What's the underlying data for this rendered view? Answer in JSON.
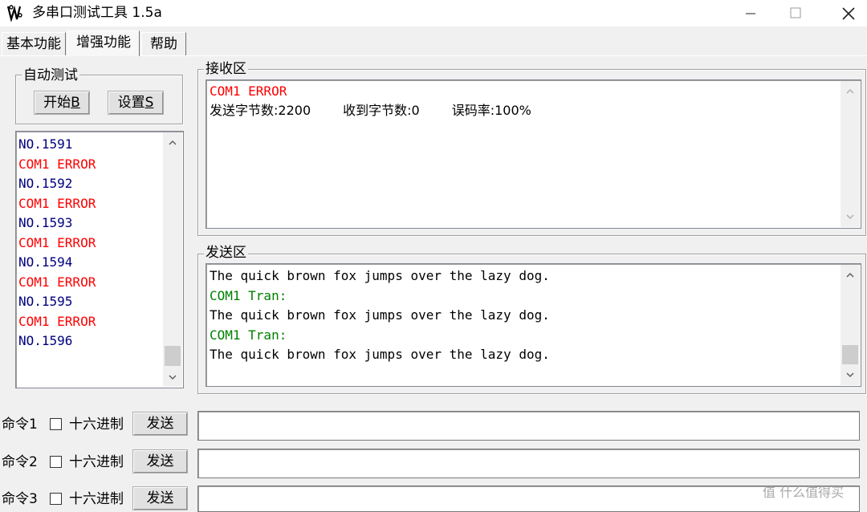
{
  "window": {
    "title": "多串口测试工具 1.5a",
    "minimize_glyph": "—",
    "maximize_glyph": "☐",
    "close_glyph": "✕"
  },
  "tabs": [
    {
      "label": "基本功能",
      "active": false
    },
    {
      "label": "增强功能",
      "active": true
    },
    {
      "label": "帮助",
      "active": false
    }
  ],
  "auto_test": {
    "group_label": "自动测试",
    "start_label": "开始",
    "start_hotkey": "B",
    "settings_label": "设置",
    "settings_hotkey": "S"
  },
  "log_list": {
    "lines": [
      {
        "text": "NO.1591",
        "color": "#00007f"
      },
      {
        "text": "COM1 ERROR",
        "color": "#ff0000"
      },
      {
        "text": "NO.1592",
        "color": "#00007f"
      },
      {
        "text": "COM1 ERROR",
        "color": "#ff0000"
      },
      {
        "text": "NO.1593",
        "color": "#00007f"
      },
      {
        "text": "COM1 ERROR",
        "color": "#ff0000"
      },
      {
        "text": "NO.1594",
        "color": "#00007f"
      },
      {
        "text": "COM1 ERROR",
        "color": "#ff0000"
      },
      {
        "text": "NO.1595",
        "color": "#00007f"
      },
      {
        "text": "COM1 ERROR",
        "color": "#ff0000"
      },
      {
        "text": "NO.1596",
        "color": "#00007f"
      }
    ]
  },
  "receive": {
    "group_label": "接收区",
    "error_line": "COM1 ERROR",
    "error_color": "#ff0000",
    "stats": {
      "sent_label": "发送字节数:",
      "sent_value": "2200",
      "received_label": "收到字节数:",
      "received_value": "0",
      "error_rate_label": "误码率:",
      "error_rate_value": "100%"
    }
  },
  "send": {
    "group_label": "发送区",
    "lines": [
      {
        "text": "The quick brown fox jumps over the lazy dog.",
        "color": "#000000"
      },
      {
        "text": "COM1 Tran:",
        "color": "#008000"
      },
      {
        "text": "The quick brown fox jumps over the lazy dog.",
        "color": "#000000"
      },
      {
        "text": "COM1 Tran:",
        "color": "#008000"
      },
      {
        "text": "The quick brown fox jumps over the lazy dog.",
        "color": "#000000"
      }
    ]
  },
  "commands": [
    {
      "label": "命令1",
      "hex_label": "十六进制",
      "hex_checked": false,
      "send_label": "发送",
      "value": ""
    },
    {
      "label": "命令2",
      "hex_label": "十六进制",
      "hex_checked": false,
      "send_label": "发送",
      "value": ""
    },
    {
      "label": "命令3",
      "hex_label": "十六进制",
      "hex_checked": false,
      "send_label": "发送",
      "value": ""
    }
  ],
  "watermark": {
    "text": "值 什么值得买",
    "icon": "值"
  }
}
